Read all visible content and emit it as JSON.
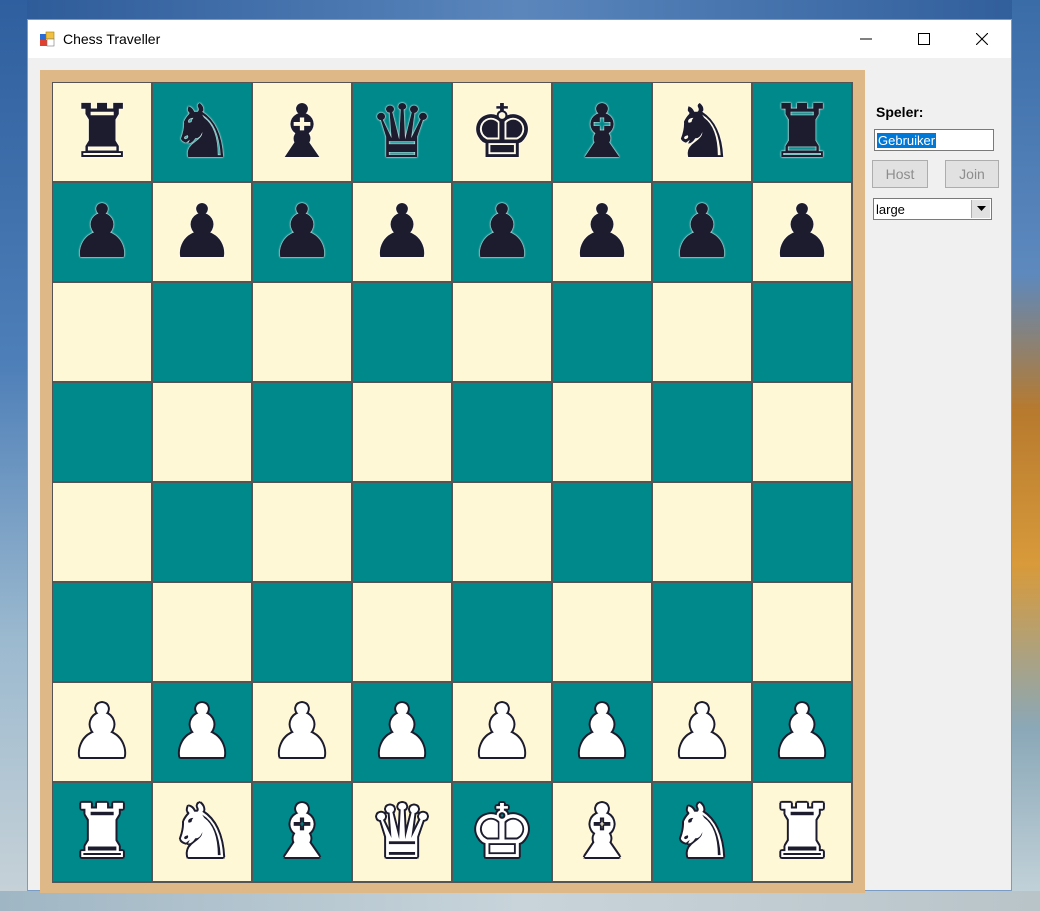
{
  "window": {
    "title": "Chess Traveller"
  },
  "sidebar": {
    "player_label": "Speler:",
    "player_name": "Gebruiker",
    "host_label": "Host",
    "join_label": "Join",
    "size_selected": "large"
  },
  "board": {
    "light_color": "#fff8d6",
    "dark_color": "#00898a",
    "frame_color": "#deb887",
    "rows": [
      [
        "black-rook",
        "black-knight",
        "black-bishop",
        "black-queen",
        "black-king",
        "black-bishop",
        "black-knight",
        "black-rook"
      ],
      [
        "black-pawn",
        "black-pawn",
        "black-pawn",
        "black-pawn",
        "black-pawn",
        "black-pawn",
        "black-pawn",
        "black-pawn"
      ],
      [
        "",
        "",
        "",
        "",
        "",
        "",
        "",
        ""
      ],
      [
        "",
        "",
        "",
        "",
        "",
        "",
        "",
        ""
      ],
      [
        "",
        "",
        "",
        "",
        "",
        "",
        "",
        ""
      ],
      [
        "",
        "",
        "",
        "",
        "",
        "",
        "",
        ""
      ],
      [
        "white-pawn",
        "white-pawn",
        "white-pawn",
        "white-pawn",
        "white-pawn",
        "white-pawn",
        "white-pawn",
        "white-pawn"
      ],
      [
        "white-rook",
        "white-knight",
        "white-bishop",
        "white-queen",
        "white-king",
        "white-bishop",
        "white-knight",
        "white-rook"
      ]
    ]
  }
}
